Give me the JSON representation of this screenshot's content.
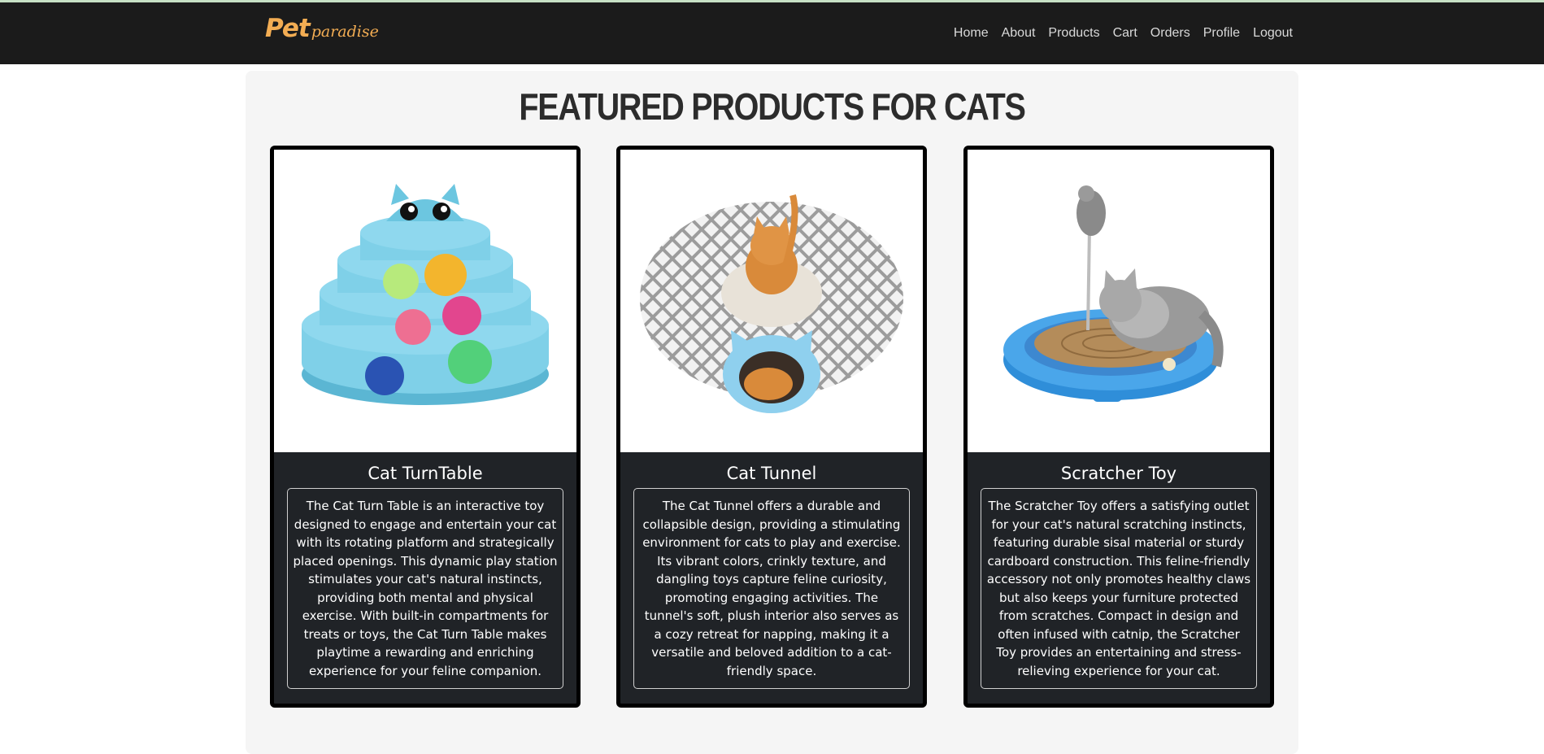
{
  "brand": {
    "logo_main": "Pet",
    "logo_sub": "paradise",
    "color": "#f3ad53"
  },
  "nav": {
    "links": [
      "Home",
      "About",
      "Products",
      "Cart",
      "Orders",
      "Profile",
      "Logout"
    ]
  },
  "page": {
    "title": "FEATURED PRODUCTS FOR CATS"
  },
  "products": [
    {
      "name": "Cat TurnTable",
      "image_icon": "cat-turntable-toy-image",
      "description": "The Cat Turn Table is an interactive toy designed to engage and entertain your cat with its rotating platform and strategically placed openings. This dynamic play station stimulates your cat's natural instincts, providing both mental and physical exercise. With built-in compartments for treats or toys, the Cat Turn Table makes playtime a rewarding and enriching experience for your feline companion."
    },
    {
      "name": "Cat Tunnel",
      "image_icon": "cat-tunnel-image",
      "description": "The Cat Tunnel offers a durable and collapsible design, providing a stimulating environment for cats to play and exercise. Its vibrant colors, crinkly texture, and dangling toys capture feline curiosity, promoting engaging activities. The tunnel's soft, plush interior also serves as a cozy retreat for napping, making it a versatile and beloved addition to a cat-friendly space."
    },
    {
      "name": "Scratcher Toy",
      "image_icon": "scratcher-toy-image",
      "description": "The Scratcher Toy offers a satisfying outlet for your cat's natural scratching instincts, featuring durable sisal material or sturdy cardboard construction. This feline-friendly accessory not only promotes healthy claws but also keeps your furniture protected from scratches. Compact in design and often infused with catnip, the Scratcher Toy provides an entertaining and stress-relieving experience for your cat."
    }
  ],
  "colors": {
    "navbar": "#1b1b1b",
    "panel": "#f5f5f5",
    "card_body": "#202327",
    "toy_blue": "#6cc6e0"
  }
}
